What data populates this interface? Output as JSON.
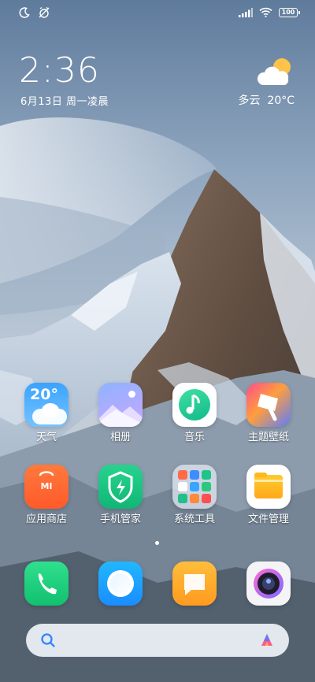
{
  "status_bar": {
    "moon_icon": "moon-icon",
    "alarm_off_icon": "alarm-off-icon",
    "signal_icon": "signal-icon",
    "wifi_icon": "wifi-icon",
    "battery_icon": "battery-icon",
    "battery_text": "100"
  },
  "widget": {
    "time": "2:36",
    "date": "6月13日  周一凌晨",
    "weather_condition": "多云",
    "temperature": "20°C",
    "weather_icon": "partly-cloudy-icon"
  },
  "apps_row1": [
    {
      "label": "天气",
      "icon": "weather-app-icon",
      "badge": "20°"
    },
    {
      "label": "相册",
      "icon": "gallery-app-icon"
    },
    {
      "label": "音乐",
      "icon": "music-app-icon"
    },
    {
      "label": "主题壁纸",
      "icon": "themes-app-icon"
    }
  ],
  "apps_row2": [
    {
      "label": "应用商店",
      "icon": "app-store-icon",
      "badge": "MI"
    },
    {
      "label": "手机管家",
      "icon": "security-app-icon"
    },
    {
      "label": "系统工具",
      "icon": "tools-folder-icon"
    },
    {
      "label": "文件管理",
      "icon": "file-manager-icon"
    }
  ],
  "dock": [
    {
      "icon": "phone-app-icon"
    },
    {
      "icon": "messages-app-icon"
    },
    {
      "icon": "notes-app-icon"
    },
    {
      "icon": "camera-app-icon"
    }
  ],
  "search_bar": {
    "search_icon": "search-icon",
    "assistant_icon": "xiaoai-assistant-icon"
  },
  "page_indicator": {
    "current": 1,
    "total": 1
  }
}
